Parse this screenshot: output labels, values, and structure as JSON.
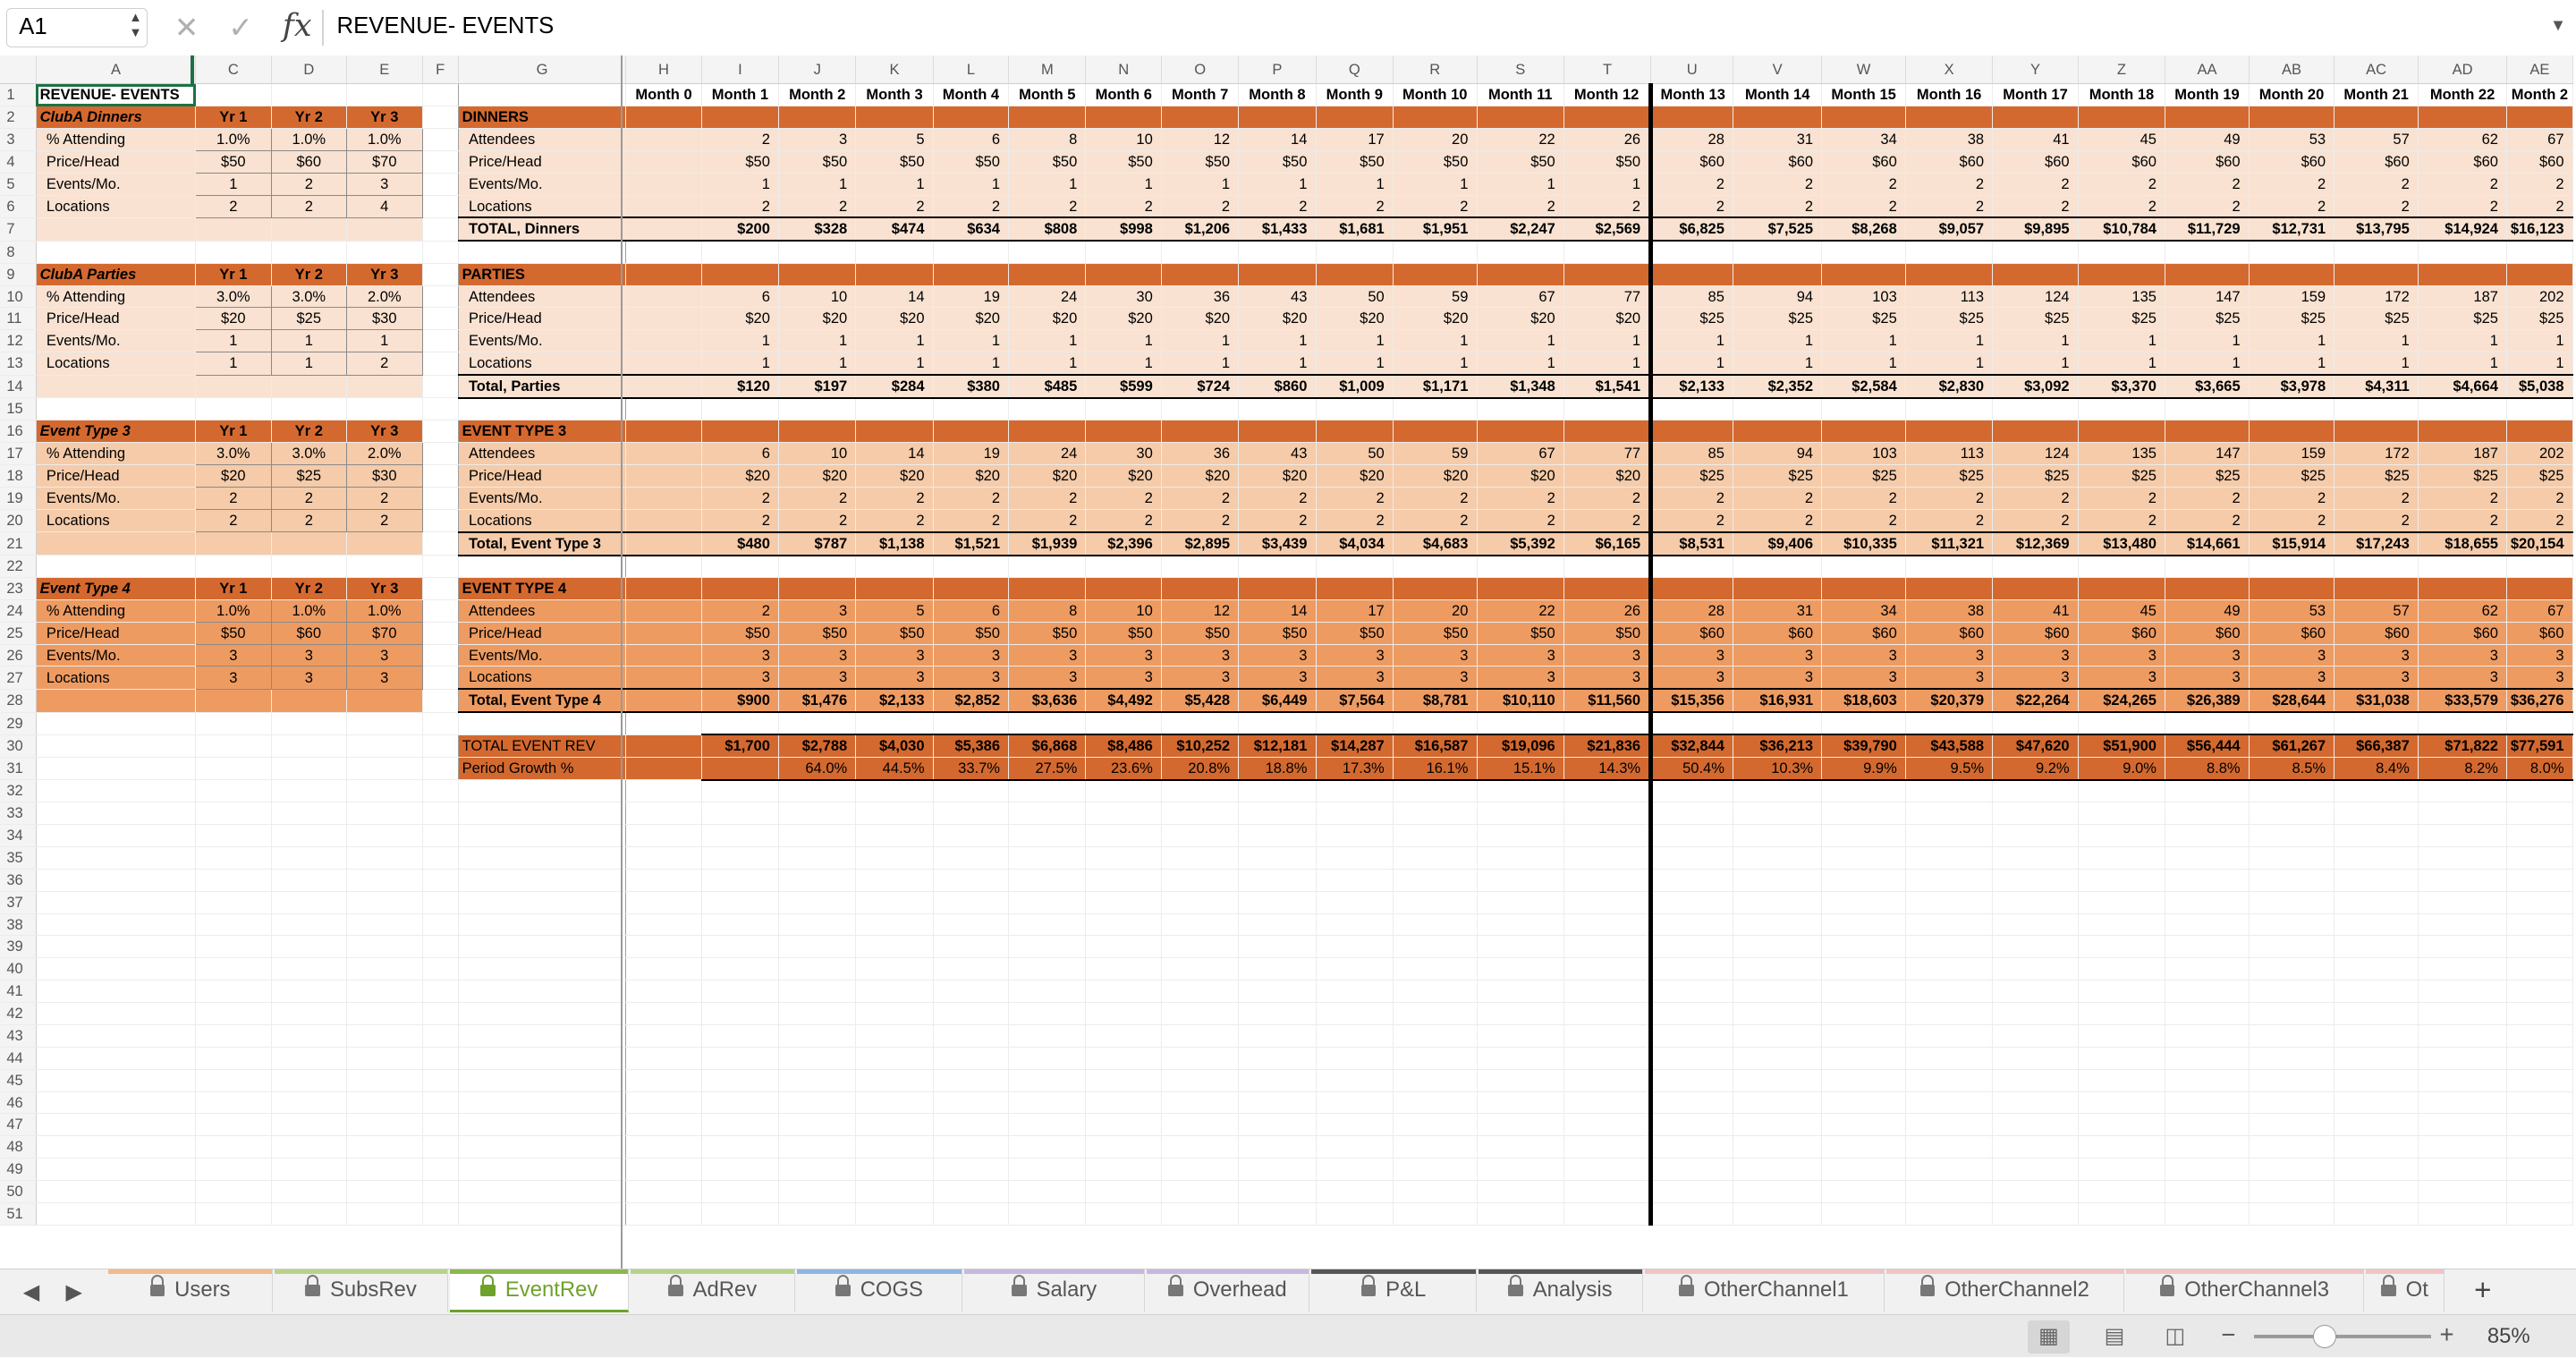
{
  "formula_bar": {
    "cell_ref": "A1",
    "fx": "fx",
    "content": "REVENUE- EVENTS"
  },
  "columns": [
    "A",
    "C",
    "D",
    "E",
    "F",
    "G",
    "H",
    "I",
    "J",
    "K",
    "L",
    "M",
    "N",
    "O",
    "P",
    "Q",
    "R",
    "S",
    "T",
    "U",
    "V",
    "W",
    "X",
    "Y",
    "Z",
    "AA",
    "AB",
    "AC",
    "AD",
    "AE"
  ],
  "title": "REVENUE- EVENTS",
  "months": [
    "Month 0",
    "Month 1",
    "Month 2",
    "Month 3",
    "Month 4",
    "Month 5",
    "Month 6",
    "Month 7",
    "Month 8",
    "Month 9",
    "Month 10",
    "Month 11",
    "Month 12",
    "Month 13",
    "Month 14",
    "Month 15",
    "Month 16",
    "Month 17",
    "Month 18",
    "Month 19",
    "Month 20",
    "Month 21",
    "Month 22",
    "Month 2"
  ],
  "sections": [
    {
      "input_title": "ClubA Dinners",
      "yr_labels": [
        "Yr 1",
        "Yr 2",
        "Yr 3"
      ],
      "band_title": "DINNERS",
      "tone": "lt",
      "inputs": [
        {
          "label": "% Attending",
          "values": [
            "1.0%",
            "1.0%",
            "1.0%"
          ]
        },
        {
          "label": "Price/Head",
          "values": [
            "$50",
            "$60",
            "$70"
          ]
        },
        {
          "label": "Events/Mo.",
          "values": [
            "1",
            "2",
            "3"
          ]
        },
        {
          "label": "Locations",
          "values": [
            "2",
            "2",
            "4"
          ]
        }
      ],
      "rows": [
        {
          "label": "Attendees",
          "values": [
            "2",
            "3",
            "5",
            "6",
            "8",
            "10",
            "12",
            "14",
            "17",
            "20",
            "22",
            "26",
            "28",
            "31",
            "34",
            "38",
            "41",
            "45",
            "49",
            "53",
            "57",
            "62",
            "67"
          ]
        },
        {
          "label": "Price/Head",
          "values": [
            "$50",
            "$50",
            "$50",
            "$50",
            "$50",
            "$50",
            "$50",
            "$50",
            "$50",
            "$50",
            "$50",
            "$50",
            "$60",
            "$60",
            "$60",
            "$60",
            "$60",
            "$60",
            "$60",
            "$60",
            "$60",
            "$60",
            "$60"
          ]
        },
        {
          "label": "Events/Mo.",
          "values": [
            "1",
            "1",
            "1",
            "1",
            "1",
            "1",
            "1",
            "1",
            "1",
            "1",
            "1",
            "1",
            "2",
            "2",
            "2",
            "2",
            "2",
            "2",
            "2",
            "2",
            "2",
            "2",
            "2"
          ]
        },
        {
          "label": "Locations",
          "values": [
            "2",
            "2",
            "2",
            "2",
            "2",
            "2",
            "2",
            "2",
            "2",
            "2",
            "2",
            "2",
            "2",
            "2",
            "2",
            "2",
            "2",
            "2",
            "2",
            "2",
            "2",
            "2",
            "2"
          ]
        }
      ],
      "total": {
        "label": "TOTAL, Dinners",
        "values": [
          "$200",
          "$328",
          "$474",
          "$634",
          "$808",
          "$998",
          "$1,206",
          "$1,433",
          "$1,681",
          "$1,951",
          "$2,247",
          "$2,569",
          "$6,825",
          "$7,525",
          "$8,268",
          "$9,057",
          "$9,895",
          "$10,784",
          "$11,729",
          "$12,731",
          "$13,795",
          "$14,924",
          "$16,123"
        ]
      }
    },
    {
      "input_title": "ClubA Parties",
      "yr_labels": [
        "Yr 1",
        "Yr 2",
        "Yr 3"
      ],
      "band_title": "PARTIES",
      "tone": "lt",
      "inputs": [
        {
          "label": "% Attending",
          "values": [
            "3.0%",
            "3.0%",
            "2.0%"
          ]
        },
        {
          "label": "Price/Head",
          "values": [
            "$20",
            "$25",
            "$30"
          ]
        },
        {
          "label": "Events/Mo.",
          "values": [
            "1",
            "1",
            "1"
          ]
        },
        {
          "label": "Locations",
          "values": [
            "1",
            "1",
            "2"
          ]
        }
      ],
      "rows": [
        {
          "label": "Attendees",
          "values": [
            "6",
            "10",
            "14",
            "19",
            "24",
            "30",
            "36",
            "43",
            "50",
            "59",
            "67",
            "77",
            "85",
            "94",
            "103",
            "113",
            "124",
            "135",
            "147",
            "159",
            "172",
            "187",
            "202"
          ]
        },
        {
          "label": "Price/Head",
          "values": [
            "$20",
            "$20",
            "$20",
            "$20",
            "$20",
            "$20",
            "$20",
            "$20",
            "$20",
            "$20",
            "$20",
            "$20",
            "$25",
            "$25",
            "$25",
            "$25",
            "$25",
            "$25",
            "$25",
            "$25",
            "$25",
            "$25",
            "$25"
          ]
        },
        {
          "label": "Events/Mo.",
          "values": [
            "1",
            "1",
            "1",
            "1",
            "1",
            "1",
            "1",
            "1",
            "1",
            "1",
            "1",
            "1",
            "1",
            "1",
            "1",
            "1",
            "1",
            "1",
            "1",
            "1",
            "1",
            "1",
            "1"
          ]
        },
        {
          "label": "Locations",
          "values": [
            "1",
            "1",
            "1",
            "1",
            "1",
            "1",
            "1",
            "1",
            "1",
            "1",
            "1",
            "1",
            "1",
            "1",
            "1",
            "1",
            "1",
            "1",
            "1",
            "1",
            "1",
            "1",
            "1"
          ]
        }
      ],
      "total": {
        "label": "Total, Parties",
        "values": [
          "$120",
          "$197",
          "$284",
          "$380",
          "$485",
          "$599",
          "$724",
          "$860",
          "$1,009",
          "$1,171",
          "$1,348",
          "$1,541",
          "$2,133",
          "$2,352",
          "$2,584",
          "$2,830",
          "$3,092",
          "$3,370",
          "$3,665",
          "$3,978",
          "$4,311",
          "$4,664",
          "$5,038"
        ]
      }
    },
    {
      "input_title": "Event Type 3",
      "yr_labels": [
        "Yr 1",
        "Yr 2",
        "Yr 3"
      ],
      "band_title": "EVENT TYPE 3",
      "tone": "md",
      "inputs": [
        {
          "label": "% Attending",
          "values": [
            "3.0%",
            "3.0%",
            "2.0%"
          ]
        },
        {
          "label": "Price/Head",
          "values": [
            "$20",
            "$25",
            "$30"
          ]
        },
        {
          "label": "Events/Mo.",
          "values": [
            "2",
            "2",
            "2"
          ]
        },
        {
          "label": "Locations",
          "values": [
            "2",
            "2",
            "2"
          ]
        }
      ],
      "rows": [
        {
          "label": "Attendees",
          "values": [
            "6",
            "10",
            "14",
            "19",
            "24",
            "30",
            "36",
            "43",
            "50",
            "59",
            "67",
            "77",
            "85",
            "94",
            "103",
            "113",
            "124",
            "135",
            "147",
            "159",
            "172",
            "187",
            "202"
          ]
        },
        {
          "label": "Price/Head",
          "values": [
            "$20",
            "$20",
            "$20",
            "$20",
            "$20",
            "$20",
            "$20",
            "$20",
            "$20",
            "$20",
            "$20",
            "$20",
            "$25",
            "$25",
            "$25",
            "$25",
            "$25",
            "$25",
            "$25",
            "$25",
            "$25",
            "$25",
            "$25"
          ]
        },
        {
          "label": "Events/Mo.",
          "values": [
            "2",
            "2",
            "2",
            "2",
            "2",
            "2",
            "2",
            "2",
            "2",
            "2",
            "2",
            "2",
            "2",
            "2",
            "2",
            "2",
            "2",
            "2",
            "2",
            "2",
            "2",
            "2",
            "2"
          ]
        },
        {
          "label": "Locations",
          "values": [
            "2",
            "2",
            "2",
            "2",
            "2",
            "2",
            "2",
            "2",
            "2",
            "2",
            "2",
            "2",
            "2",
            "2",
            "2",
            "2",
            "2",
            "2",
            "2",
            "2",
            "2",
            "2",
            "2"
          ]
        }
      ],
      "total": {
        "label": "Total, Event Type 3",
        "values": [
          "$480",
          "$787",
          "$1,138",
          "$1,521",
          "$1,939",
          "$2,396",
          "$2,895",
          "$3,439",
          "$4,034",
          "$4,683",
          "$5,392",
          "$6,165",
          "$8,531",
          "$9,406",
          "$10,335",
          "$11,321",
          "$12,369",
          "$13,480",
          "$14,661",
          "$15,914",
          "$17,243",
          "$18,655",
          "$20,154"
        ]
      }
    },
    {
      "input_title": "Event Type 4",
      "yr_labels": [
        "Yr 1",
        "Yr 2",
        "Yr 3"
      ],
      "band_title": "EVENT TYPE 4",
      "tone": "dk",
      "inputs": [
        {
          "label": "% Attending",
          "values": [
            "1.0%",
            "1.0%",
            "1.0%"
          ]
        },
        {
          "label": "Price/Head",
          "values": [
            "$50",
            "$60",
            "$70"
          ]
        },
        {
          "label": "Events/Mo.",
          "values": [
            "3",
            "3",
            "3"
          ]
        },
        {
          "label": "Locations",
          "values": [
            "3",
            "3",
            "3"
          ]
        }
      ],
      "rows": [
        {
          "label": "Attendees",
          "values": [
            "2",
            "3",
            "5",
            "6",
            "8",
            "10",
            "12",
            "14",
            "17",
            "20",
            "22",
            "26",
            "28",
            "31",
            "34",
            "38",
            "41",
            "45",
            "49",
            "53",
            "57",
            "62",
            "67"
          ]
        },
        {
          "label": "Price/Head",
          "values": [
            "$50",
            "$50",
            "$50",
            "$50",
            "$50",
            "$50",
            "$50",
            "$50",
            "$50",
            "$50",
            "$50",
            "$50",
            "$60",
            "$60",
            "$60",
            "$60",
            "$60",
            "$60",
            "$60",
            "$60",
            "$60",
            "$60",
            "$60"
          ]
        },
        {
          "label": "Events/Mo.",
          "values": [
            "3",
            "3",
            "3",
            "3",
            "3",
            "3",
            "3",
            "3",
            "3",
            "3",
            "3",
            "3",
            "3",
            "3",
            "3",
            "3",
            "3",
            "3",
            "3",
            "3",
            "3",
            "3",
            "3"
          ]
        },
        {
          "label": "Locations",
          "values": [
            "3",
            "3",
            "3",
            "3",
            "3",
            "3",
            "3",
            "3",
            "3",
            "3",
            "3",
            "3",
            "3",
            "3",
            "3",
            "3",
            "3",
            "3",
            "3",
            "3",
            "3",
            "3",
            "3"
          ]
        }
      ],
      "total": {
        "label": "Total, Event Type 4",
        "values": [
          "$900",
          "$1,476",
          "$2,133",
          "$2,852",
          "$3,636",
          "$4,492",
          "$5,428",
          "$6,449",
          "$7,564",
          "$8,781",
          "$10,110",
          "$11,560",
          "$15,356",
          "$16,931",
          "$18,603",
          "$20,379",
          "$22,264",
          "$24,265",
          "$26,389",
          "$28,644",
          "$31,038",
          "$33,579",
          "$36,276"
        ]
      }
    }
  ],
  "total_rev": {
    "label": "TOTAL EVENT REV",
    "values": [
      "$1,700",
      "$2,788",
      "$4,030",
      "$5,386",
      "$6,868",
      "$8,486",
      "$10,252",
      "$12,181",
      "$14,287",
      "$16,587",
      "$19,096",
      "$21,836",
      "$32,844",
      "$36,213",
      "$39,790",
      "$43,588",
      "$47,620",
      "$51,900",
      "$56,444",
      "$61,267",
      "$66,387",
      "$71,822",
      "$77,591"
    ]
  },
  "growth": {
    "label": "Period Growth %",
    "values": [
      "",
      "64.0%",
      "44.5%",
      "33.7%",
      "27.5%",
      "23.6%",
      "20.8%",
      "18.8%",
      "17.3%",
      "16.1%",
      "15.1%",
      "14.3%",
      "50.4%",
      "10.3%",
      "9.9%",
      "9.5%",
      "9.2%",
      "9.0%",
      "8.8%",
      "8.5%",
      "8.4%",
      "8.2%",
      "8.0%"
    ]
  },
  "sheet_tabs": [
    {
      "name": "Users",
      "color": "#f3b98a"
    },
    {
      "name": "SubsRev",
      "color": "#b9d28a"
    },
    {
      "name": "EventRev",
      "color": "#8cb74e"
    },
    {
      "name": "AdRev",
      "color": "#b9d28a"
    },
    {
      "name": "COGS",
      "color": "#8fb4e3"
    },
    {
      "name": "Salary",
      "color": "#c7b8dd"
    },
    {
      "name": "Overhead",
      "color": "#c7b8dd"
    },
    {
      "name": "P&L",
      "color": "#555555"
    },
    {
      "name": "Analysis",
      "color": "#555555"
    },
    {
      "name": "OtherChannel1",
      "color": "#f0c4c4"
    },
    {
      "name": "OtherChannel2",
      "color": "#f0c4c4"
    },
    {
      "name": "OtherChannel3",
      "color": "#f0c4c4"
    },
    {
      "name": "Ot",
      "color": "#f0c4c4"
    }
  ],
  "status": {
    "zoom": "85%"
  },
  "colors": {
    "header_band": "#d4692f",
    "light_fill": "#f9e2d1",
    "medium_fill": "#f5cba9",
    "dark_fill": "#ee9b62",
    "active_tab": "#6ea22b"
  }
}
